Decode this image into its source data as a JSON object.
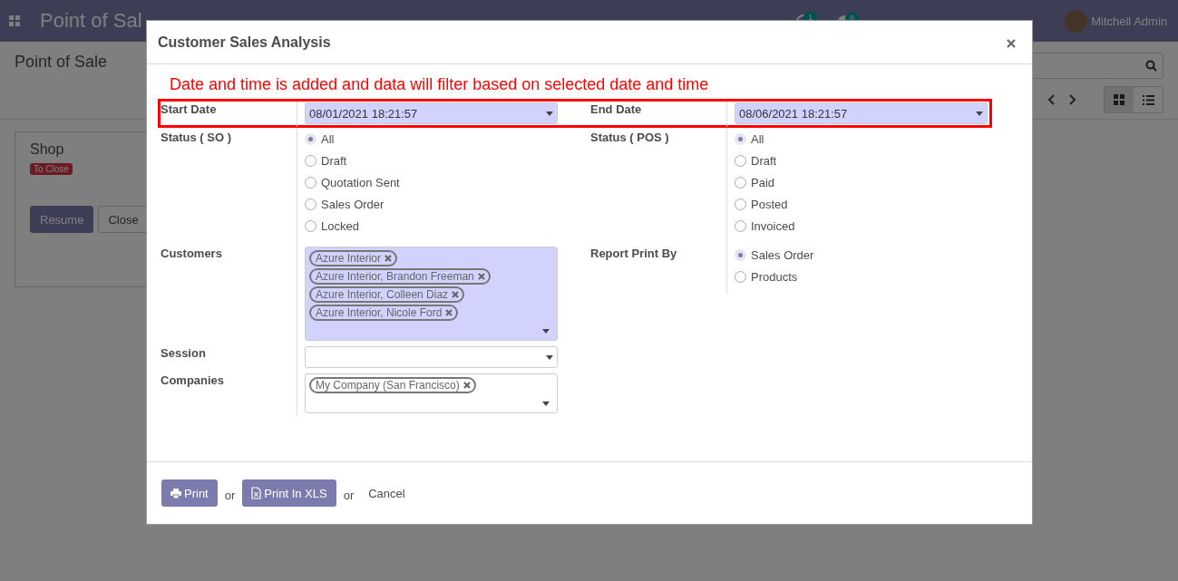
{
  "navbar": {
    "app_title": "Point of Sal",
    "activity_count": "1",
    "message_count": "6",
    "user": "Mitchell Admin"
  },
  "control_panel": {
    "breadcrumb": "Point of Sale",
    "views": [
      {
        "selected": true
      },
      {
        "selected": false
      }
    ]
  },
  "kanban_card": {
    "title": "Shop",
    "status": "To Close",
    "buttons": [
      "Resume",
      "Close"
    ]
  },
  "dialog": {
    "title": "Customer Sales Analysis",
    "note": "Date and time is added and data will filter based on selected date and time",
    "dates": [
      {
        "label": "Start Date",
        "value": "08/01/2021 18:21:57",
        "required": true
      },
      {
        "label": "End Date",
        "value": "08/06/2021 18:21:57",
        "required": true
      }
    ],
    "left_fields": [
      {
        "kind": "radio",
        "label": "Status ( SO )",
        "options": [
          {
            "label": "All",
            "selected": true
          },
          {
            "label": "Draft",
            "selected": false
          },
          {
            "label": "Quotation Sent",
            "selected": false
          },
          {
            "label": "Sales Order",
            "selected": false
          },
          {
            "label": "Locked",
            "selected": false
          }
        ]
      },
      {
        "kind": "tags",
        "label": "Customers",
        "required": true,
        "tags": [
          "Azure Interior",
          "Azure Interior, Brandon Freeman",
          "Azure Interior, Colleen Diaz",
          "Azure Interior, Nicole Ford"
        ]
      },
      {
        "kind": "select",
        "label": "Session",
        "required": false
      },
      {
        "kind": "tags",
        "label": "Companies",
        "required": false,
        "tags": [
          "My Company (San Francisco)"
        ]
      }
    ],
    "right_fields": [
      {
        "kind": "radio",
        "label": "Status ( POS )",
        "options": [
          {
            "label": "All",
            "selected": true
          },
          {
            "label": "Draft",
            "selected": false
          },
          {
            "label": "Paid",
            "selected": false
          },
          {
            "label": "Posted",
            "selected": false
          },
          {
            "label": "Invoiced",
            "selected": false
          }
        ]
      },
      {
        "kind": "radio",
        "label": "Report Print By",
        "options": [
          {
            "label": "Sales Order",
            "selected": true
          },
          {
            "label": "Products",
            "selected": false
          }
        ]
      }
    ],
    "footer": [
      {
        "kind": "button",
        "label": "Print"
      },
      {
        "kind": "text",
        "label": "or"
      },
      {
        "kind": "button",
        "label": "Print In XLS"
      },
      {
        "kind": "text",
        "label": "or"
      },
      {
        "kind": "link",
        "label": "Cancel"
      }
    ]
  }
}
